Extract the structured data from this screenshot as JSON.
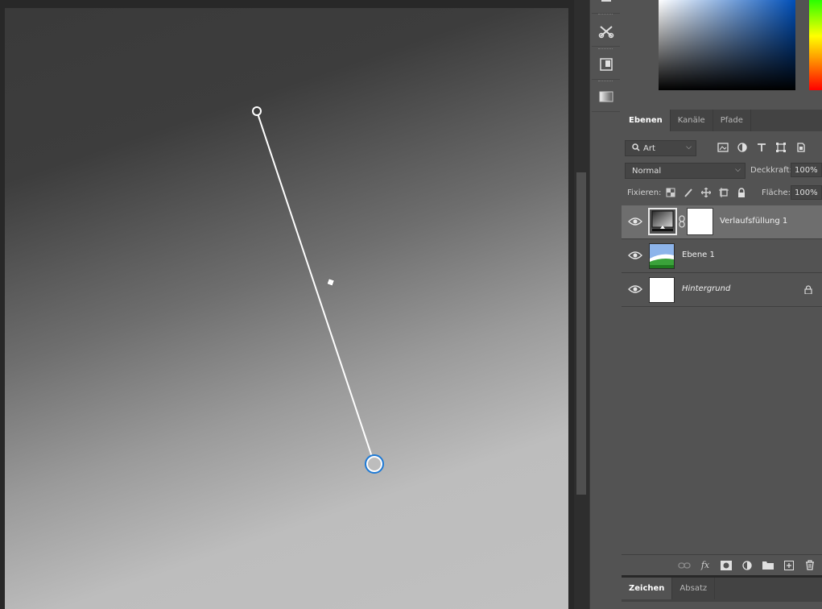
{
  "canvas": {
    "gradient_controls": {
      "start_handle": "gradient-start-handle",
      "end_handle": "gradient-end-handle",
      "midpoint": "gradient-midpoint-diamond"
    }
  },
  "toolbar": {
    "tools": [
      "crop-tools-icon",
      "properties-icon",
      "gradient-icon"
    ]
  },
  "layers_panel": {
    "tabs": [
      {
        "label": "Ebenen",
        "active": true
      },
      {
        "label": "Kanäle",
        "active": false
      },
      {
        "label": "Pfade",
        "active": false
      }
    ],
    "filter_kind": "Art",
    "blend_mode": "Normal",
    "opacity_label": "Deckkraft:",
    "opacity_value": "100%",
    "lock_label": "Fixieren:",
    "fill_label": "Fläche:",
    "fill_value": "100%",
    "layers": [
      {
        "name": "Verlaufsfüllung 1",
        "selected": true,
        "visible": true,
        "type": "gradient-fill"
      },
      {
        "name": "Ebene 1",
        "selected": false,
        "visible": true,
        "type": "image"
      },
      {
        "name": "Hintergrund",
        "selected": false,
        "visible": true,
        "type": "background",
        "locked": true
      }
    ]
  },
  "bottom_panel": {
    "tabs": [
      {
        "label": "Zeichen",
        "active": true
      },
      {
        "label": "Absatz",
        "active": false
      }
    ]
  },
  "colors": {
    "panel_bg": "#535353",
    "selected_layer_bg": "#6e6e6e",
    "handle_accent": "#1e7ad6"
  }
}
